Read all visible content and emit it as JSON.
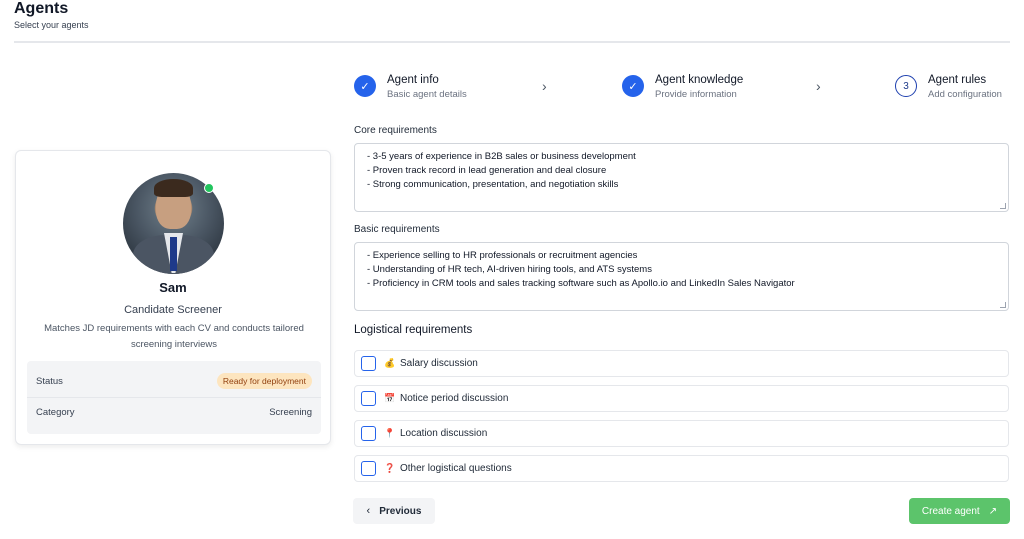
{
  "header": {
    "title": "Agents",
    "subtitle": "Select your agents"
  },
  "agent": {
    "name": "Sam",
    "role": "Candidate Screener",
    "description": "Matches JD requirements with each CV and conducts tailored screening interviews",
    "online_status_color": "#22c55e",
    "status_label": "Status",
    "status_value": "Ready for deployment",
    "category_label": "Category",
    "category_value": "Screening"
  },
  "stepper": {
    "steps": [
      {
        "title": "Agent info",
        "subtitle": "Basic agent details",
        "state": "done",
        "marker": "✓"
      },
      {
        "title": "Agent knowledge",
        "subtitle": "Provide information",
        "state": "done",
        "marker": "✓"
      },
      {
        "title": "Agent rules",
        "subtitle": "Add configuration",
        "state": "current",
        "marker": "3"
      }
    ],
    "separator": "›"
  },
  "form": {
    "core": {
      "label": "Core requirements",
      "lines": [
        "- 3-5 years of experience in B2B sales or business development",
        "- Proven track record in lead generation and deal closure",
        "- Strong communication, presentation, and negotiation skills"
      ]
    },
    "basic": {
      "label": "Basic requirements",
      "lines": [
        "- Experience selling to HR professionals or recruitment agencies",
        "- Understanding of HR tech, AI-driven hiring tools, and ATS systems",
        "- Proficiency in CRM tools and sales tracking software such as Apollo.io and LinkedIn Sales Navigator"
      ]
    },
    "logistical": {
      "title": "Logistical requirements",
      "options": [
        {
          "emoji": "💰",
          "label": "Salary discussion",
          "checked": false
        },
        {
          "emoji": "📅",
          "label": "Notice period discussion",
          "checked": false
        },
        {
          "emoji": "📍",
          "label": "Location discussion",
          "checked": false
        },
        {
          "emoji": "❓",
          "label": "Other logistical questions",
          "checked": false
        }
      ]
    }
  },
  "actions": {
    "previous_icon": "‹",
    "previous_label": "Previous",
    "create_label": "Create agent",
    "create_icon": "↗",
    "create_color": "#5cc46b"
  }
}
